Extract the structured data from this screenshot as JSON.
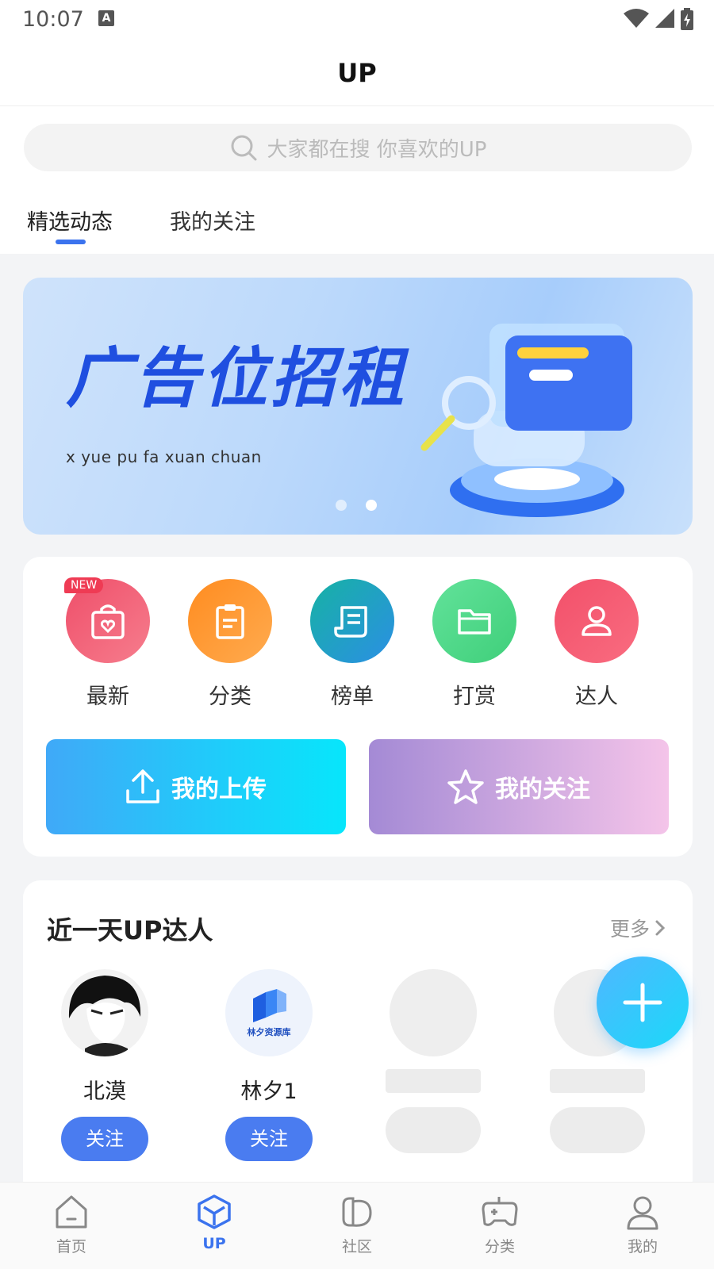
{
  "status": {
    "time": "10:07",
    "a_icon": "A"
  },
  "header": {
    "title": "UP"
  },
  "search": {
    "placeholder": "大家都在搜 你喜欢的UP"
  },
  "tabs": [
    {
      "label": "精选动态",
      "active": true
    },
    {
      "label": "我的关注",
      "active": false
    }
  ],
  "banner": {
    "title": "广告位招租",
    "subtitle": "x yue pu fa xuan chuan",
    "page_count": 2,
    "active_page": 2
  },
  "quick": {
    "items": [
      {
        "label": "最新",
        "icon": "shopping-bag-heart-icon",
        "badge": "NEW",
        "color": "#ef5b73"
      },
      {
        "label": "分类",
        "icon": "clipboard-icon",
        "color": "#ff9a2e"
      },
      {
        "label": "榜单",
        "icon": "scroll-list-icon",
        "color": "#2cb3c7"
      },
      {
        "label": "打赏",
        "icon": "folder-icon",
        "color": "#4fd98a"
      },
      {
        "label": "达人",
        "icon": "user-icon",
        "color": "#f25a6f"
      }
    ],
    "upload_label": "我的上传",
    "follow_label": "我的关注"
  },
  "up": {
    "title": "近一天UP达人",
    "more_label": "更多",
    "people": [
      {
        "name": "北漠",
        "follow_label": "关注"
      },
      {
        "name": "林夕1",
        "follow_label": "关注",
        "logo_text": "林夕资源库"
      }
    ]
  },
  "nav": [
    {
      "label": "首页",
      "icon": "home-icon",
      "active": false
    },
    {
      "label": "UP",
      "icon": "cube-icon",
      "active": true
    },
    {
      "label": "社区",
      "icon": "community-icon",
      "active": false
    },
    {
      "label": "分类",
      "icon": "gamepad-icon",
      "active": false
    },
    {
      "label": "我的",
      "icon": "profile-icon",
      "active": false
    }
  ],
  "colors": {
    "accent": "#3b73ee",
    "follow": "#4a7cf0"
  }
}
